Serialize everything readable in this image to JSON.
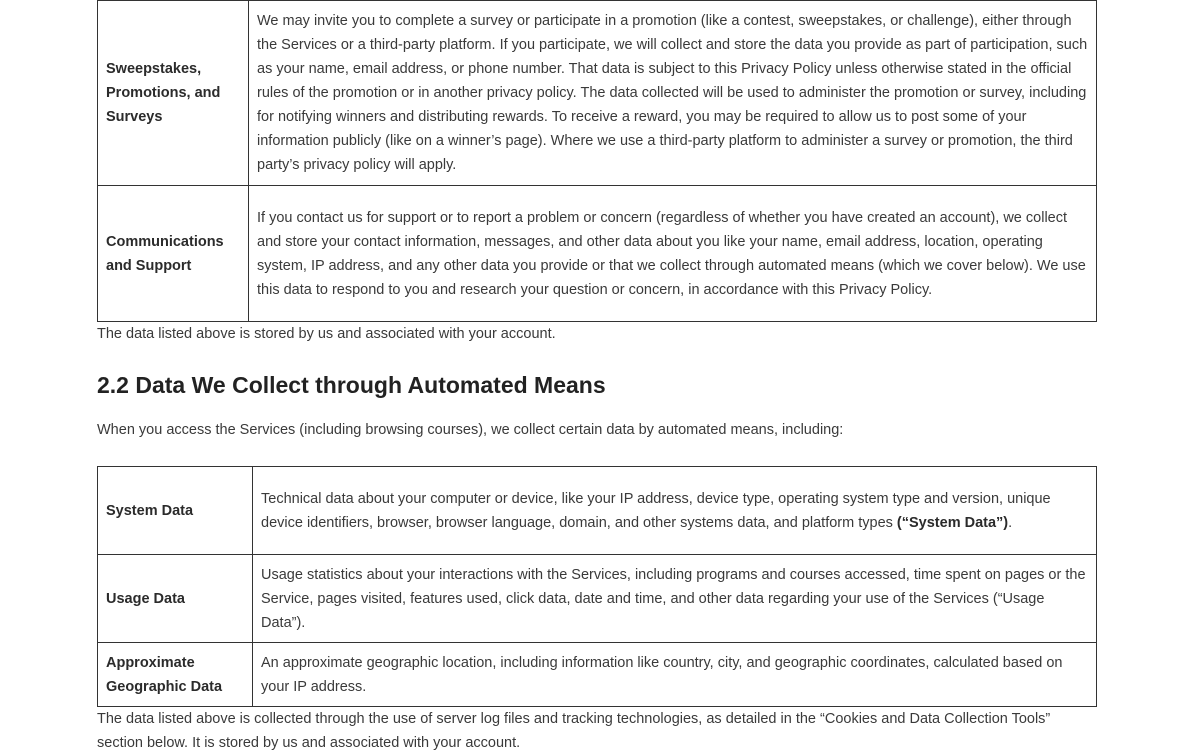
{
  "table1": {
    "rows": [
      {
        "label": "Sweepstakes, Promotions, and Surveys",
        "desc": "We may invite you to complete a survey or participate in a promotion (like a contest, sweepstakes, or challenge), either through the Services or a third-party platform. If you participate, we will collect and store the data you provide as part of participation, such as your name, email address, or phone number. That data is subject to this Privacy Policy unless otherwise stated in the official rules of the promotion or in another privacy policy. The data collected will be used to administer the promotion or survey, including for notifying winners and distributing rewards. To receive a reward, you may be required to allow us to post some of your information publicly (like on a winner’s page). Where we use a third-party platform to administer a survey or promotion, the third party’s privacy policy will apply."
      },
      {
        "label": "Communications and Support",
        "desc": "If you contact us for support or to report a problem or concern (regardless of whether you have created an account), we collect and store your contact information, messages, and other data about you like your name, email address, location, operating system, IP address, and any other data you provide or that we collect through automated means (which we cover below). We use this data to respond to you and research your question or concern, in accordance with this Privacy Policy."
      }
    ]
  },
  "note1": "The data listed above is stored by us and associated with your account.",
  "section_title": "2.2 Data We Collect through Automated Means",
  "intro": "When you access the Services (including browsing courses), we collect certain data by automated means, including:",
  "table2": {
    "rows": [
      {
        "label": "System Data",
        "desc": "Technical data about your computer or device, like your IP address, device type, operating system type and version, unique device identifiers, browser, browser language, domain, and other systems data, and platform types ",
        "desc_bold": "(“System Data”)",
        "desc_tail": "."
      },
      {
        "label": "Usage Data",
        "desc": "Usage statistics about your interactions with the Services, including programs and courses accessed, time spent on pages or the Service, pages visited, features used, click data, date and time, and other data regarding your use of the Services (“Usage Data”)."
      },
      {
        "label": "Approximate Geographic Data",
        "desc": "An approximate geographic location, including information like country, city, and geographic coordinates, calculated based on your IP address."
      }
    ]
  },
  "note2": "The data listed above is collected through the use of server log files and tracking technologies, as detailed in the “Cookies and Data Collection Tools” section below. It is stored by us and associated with your account."
}
